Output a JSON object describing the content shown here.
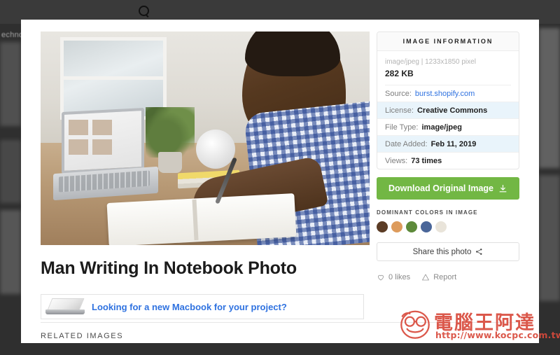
{
  "backdrop": {
    "ghost_text": "echno"
  },
  "photo": {
    "alt_name": "man-writing-in-notebook-photo"
  },
  "main": {
    "title": "Man Writing In Notebook Photo",
    "promo_link": "Looking for a new Macbook for your project?",
    "related_label": "RELATED IMAGES"
  },
  "info_card": {
    "header": "IMAGE INFORMATION",
    "file_type_line": "image/jpeg | 1233x1850 pixel",
    "file_size": "282 KB",
    "rows": [
      {
        "key": "Source:",
        "value": "burst.shopify.com",
        "is_link": true,
        "highlight": false
      },
      {
        "key": "License:",
        "value": "Creative Commons",
        "is_link": false,
        "highlight": true
      },
      {
        "key": "File Type:",
        "value": "image/jpeg",
        "is_link": false,
        "highlight": false
      },
      {
        "key": "Date Added:",
        "value": "Feb 11, 2019",
        "is_link": false,
        "highlight": true
      },
      {
        "key": "Views:",
        "value": "73 times",
        "is_link": false,
        "highlight": false
      }
    ],
    "download_label": "Download Original Image",
    "download_icon": "download-icon",
    "download_color": "#72b744",
    "dominant_label": "DOMINANT COLORS IN IMAGE",
    "dominant_colors": [
      "#5b3c25",
      "#dd9b5c",
      "#5d8a3a",
      "#4a6699",
      "#e9e4da"
    ],
    "share_label": "Share this photo",
    "share_icon": "share-icon",
    "likes_label": "0 likes",
    "likes_icon": "heart-icon",
    "report_label": "Report",
    "report_icon": "warning-triangle-icon",
    "link_color": "#2f72e0",
    "highlight_color": "#e9f4fb"
  },
  "watermark": {
    "brand": "電腦王阿達",
    "url": "http://www.kocpc.com.tw",
    "color": "#d94a3c"
  }
}
